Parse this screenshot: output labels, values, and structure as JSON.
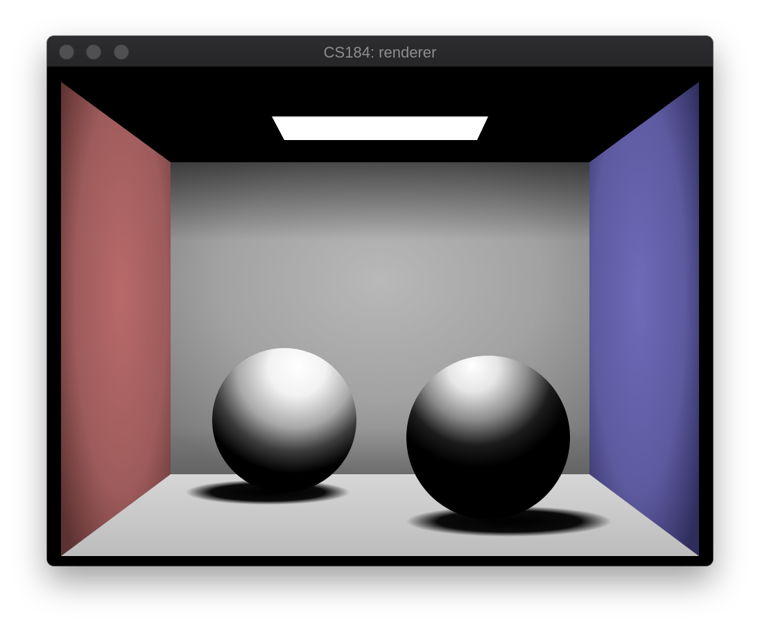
{
  "window": {
    "title": "CS184: renderer",
    "controls": [
      "close-button",
      "minimize-button",
      "zoom-button"
    ]
  },
  "scene": {
    "description_shown": false,
    "colors": {
      "left_wall": "#b06464",
      "right_wall": "#6a67b0",
      "back_wall": "#b0b0b0",
      "floor": "#d8d8d8",
      "ceiling": "#000000",
      "light": "#ffffff",
      "sphere": "#ffffff"
    }
  }
}
